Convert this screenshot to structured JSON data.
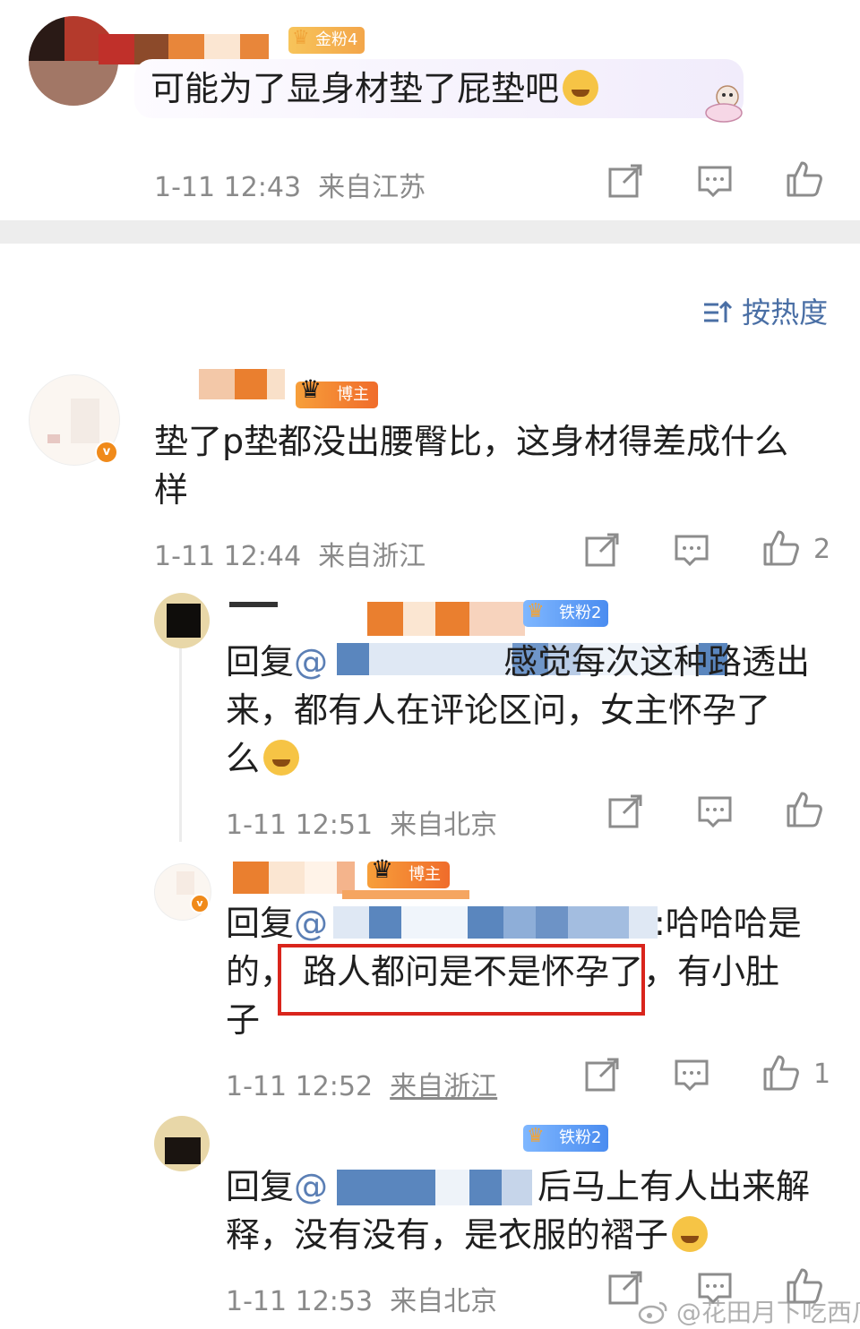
{
  "top_comment": {
    "fan_badge": "金粉4",
    "text": "可能为了显身材垫了屁垫吧",
    "time": "1-11 12:43",
    "location": "来自江苏"
  },
  "sort": {
    "label": "按热度",
    "icon": "sort-icon"
  },
  "comment1": {
    "badge": "博主",
    "text_line1": "垫了p垫都没出腰臀比，这身材得差成什么",
    "text_line2": "样",
    "time": "1-11 12:44",
    "location": "来自浙江",
    "likes": "2"
  },
  "reply1": {
    "badge": "铁粉2",
    "prefix": "回复",
    "mention": "@",
    "line1_tail": "感觉每次这种路透出",
    "line2": "来，都有人在评论区问，女主怀孕了",
    "line3": "么",
    "time": "1-11 12:51",
    "location": "来自北京"
  },
  "reply2": {
    "badge": "博主",
    "prefix": "回复",
    "mention": "@",
    "line1_tail": ":哈哈哈是",
    "line2_a": "的，",
    "line2_highlight": "路人都问是不是怀孕了",
    "line2_b": "，有小肚",
    "line3": "子",
    "time": "1-11 12:52",
    "location": "来自浙江",
    "likes": "1"
  },
  "reply3": {
    "badge": "铁粉2",
    "prefix": "回复",
    "mention": "@",
    "line1_tail": "后马上有人出来解",
    "line2": "释，没有没有，是衣服的褶子",
    "time": "1-11 12:53",
    "location": "来自北京"
  },
  "watermark": "@花田月下吃西瓜",
  "colors": {
    "highlight_box": "#d9251c",
    "meta": "#8a8a8a",
    "divider": "#ededed"
  }
}
